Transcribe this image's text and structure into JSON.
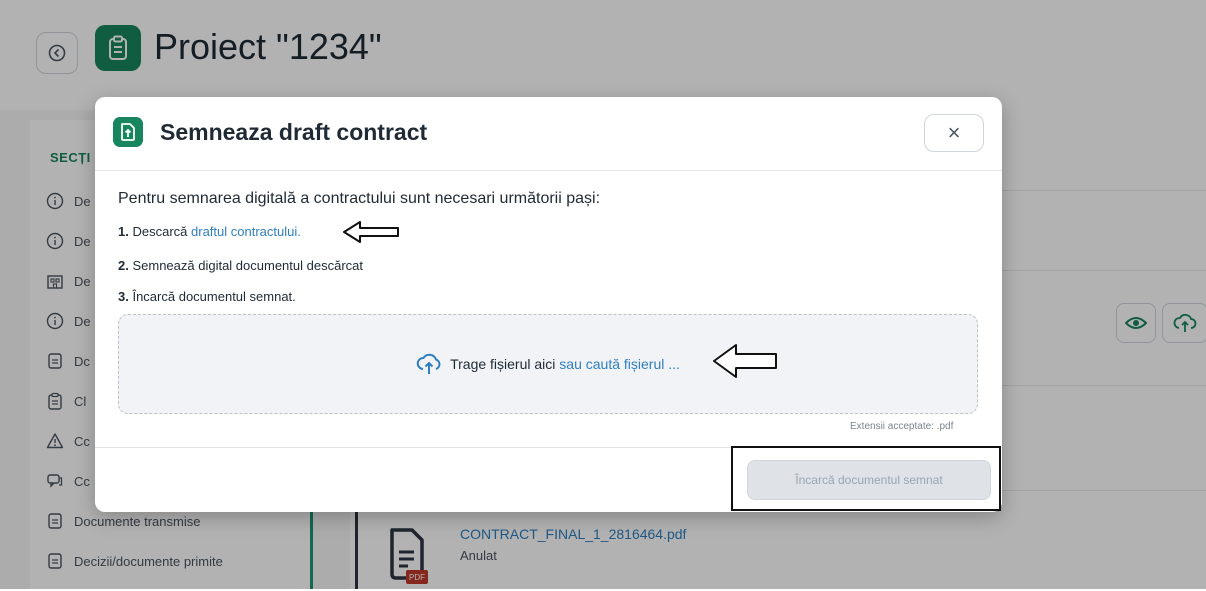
{
  "project": {
    "title": "Proiect \"1234\""
  },
  "sidebar": {
    "section_title": "SECȚI",
    "items": [
      {
        "label": "De",
        "icon": "info-icon"
      },
      {
        "label": "De",
        "icon": "info-icon"
      },
      {
        "label": "De",
        "icon": "building-icon"
      },
      {
        "label": "De",
        "icon": "info-icon"
      },
      {
        "label": "Dc",
        "icon": "document-icon"
      },
      {
        "label": "Cl",
        "icon": "clipboard-icon"
      },
      {
        "label": "Cc",
        "icon": "warning-icon"
      },
      {
        "label": "Cc",
        "icon": "chat-icon"
      },
      {
        "label": "Documente transmise",
        "icon": "document-icon"
      },
      {
        "label": "Decizii/documente primite",
        "icon": "document-icon"
      }
    ]
  },
  "file": {
    "name": "CONTRACT_FINAL_1_2816464.pdf",
    "status": "Anulat",
    "badge": "PDF"
  },
  "modal": {
    "title": "Semneaza draft contract",
    "close_label": "×",
    "intro": "Pentru semnarea digitală a contractului sunt necesari următorii pași:",
    "step1_num": "1.",
    "step1_text": "Descarcă",
    "step1_link": "draftul contractului.",
    "step2_num": "2.",
    "step2_text": "Semnează digital documentul descărcat",
    "step3_num": "3.",
    "step3_text": "Încarcă documentul semnat.",
    "dropzone_text": "Trage fișierul aici",
    "dropzone_or": "sau",
    "dropzone_link": "caută fișierul ...",
    "extensions_note": "Extensii acceptate: .pdf",
    "upload_button": "Încarcă documentul semnat"
  },
  "colors": {
    "brand_green": "#17865e",
    "link_blue": "#2f7fc0",
    "disabled_button": "#dfe3e8"
  }
}
